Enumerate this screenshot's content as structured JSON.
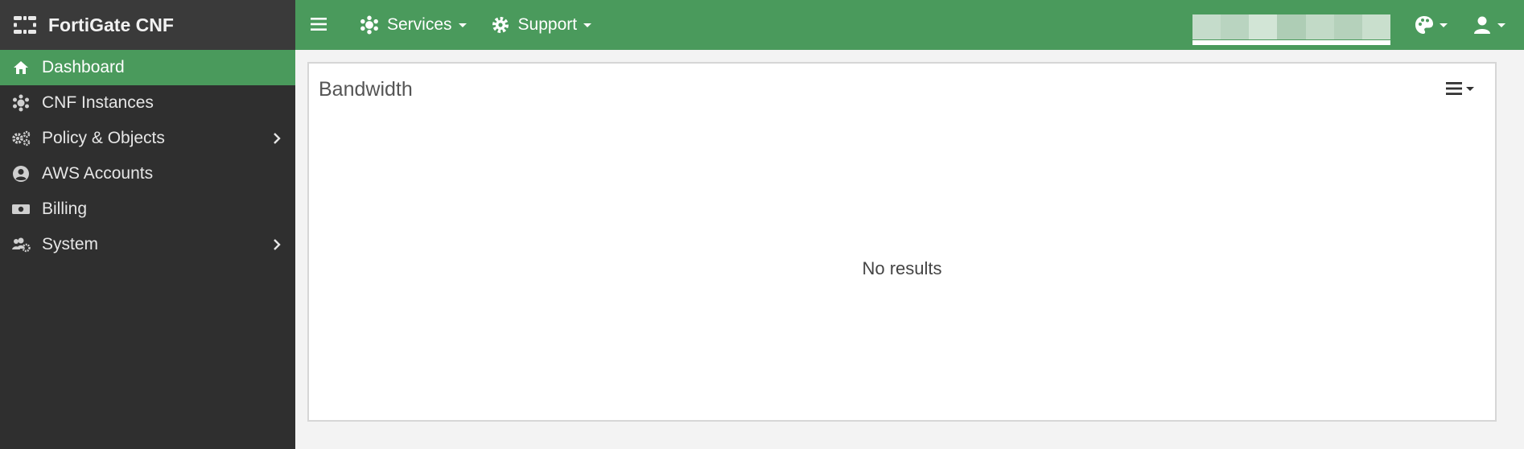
{
  "brand": {
    "title": "FortiGate CNF",
    "icon": "grid-icon"
  },
  "sidebar": {
    "items": [
      {
        "label": "Dashboard",
        "icon": "home-icon",
        "active": true,
        "has_submenu": false
      },
      {
        "label": "CNF Instances",
        "icon": "network-icon",
        "active": false,
        "has_submenu": false
      },
      {
        "label": "Policy & Objects",
        "icon": "cogs-icon",
        "active": false,
        "has_submenu": true
      },
      {
        "label": "AWS Accounts",
        "icon": "user-circle-icon",
        "active": false,
        "has_submenu": false
      },
      {
        "label": "Billing",
        "icon": "money-icon",
        "active": false,
        "has_submenu": false
      },
      {
        "label": "System",
        "icon": "users-cog-icon",
        "active": false,
        "has_submenu": true
      }
    ]
  },
  "topbar": {
    "menus": [
      {
        "label": "Services",
        "icon": "network-icon"
      },
      {
        "label": "Support",
        "icon": "gear-icon"
      }
    ],
    "right_icons": [
      "palette-icon",
      "user-icon"
    ]
  },
  "panel": {
    "title": "Bandwidth",
    "empty_text": "No results",
    "menu_icon": "list-icon"
  },
  "colors": {
    "accent": "#4a9a5c",
    "sidebar_bg": "#2f2f2f",
    "brand_bg": "#3a3a3a"
  }
}
